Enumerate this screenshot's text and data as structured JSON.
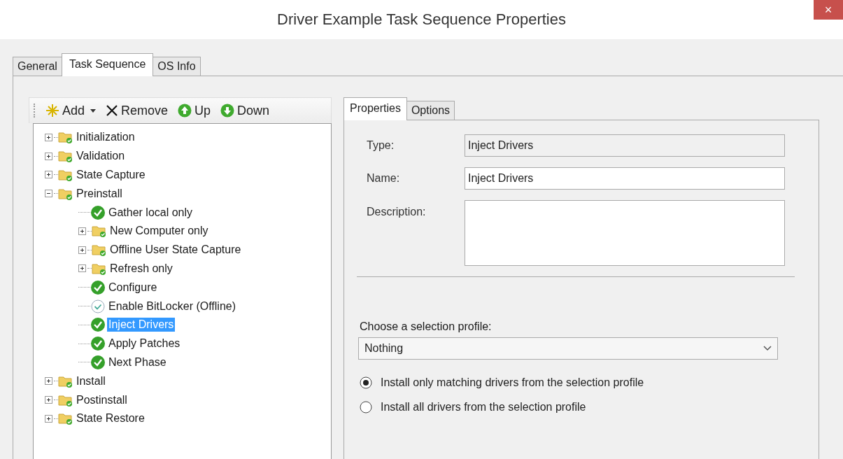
{
  "window": {
    "title": "Driver Example Task Sequence Properties",
    "close": "×"
  },
  "tabs": [
    {
      "label": "General",
      "selected": false
    },
    {
      "label": "Task Sequence",
      "selected": true
    },
    {
      "label": "OS Info",
      "selected": false
    }
  ],
  "toolbar": [
    {
      "label": "Add",
      "kind": "add"
    },
    {
      "label": "Remove",
      "kind": "remove"
    },
    {
      "label": "Up",
      "kind": "up"
    },
    {
      "label": "Down",
      "kind": "down"
    }
  ],
  "tree": [
    {
      "label": "Initialization",
      "kind": "folder",
      "expanded": false,
      "selected": false
    },
    {
      "label": "Validation",
      "kind": "folder",
      "expanded": false,
      "selected": false
    },
    {
      "label": "State Capture",
      "kind": "folder",
      "expanded": false,
      "selected": false
    },
    {
      "label": "Preinstall",
      "kind": "folder",
      "expanded": true,
      "selected": false,
      "children": [
        {
          "label": "Gather local only",
          "kind": "step",
          "selected": false
        },
        {
          "label": "New Computer only",
          "kind": "folder",
          "expanded": false,
          "selected": false
        },
        {
          "label": "Offline User State Capture",
          "kind": "folder",
          "expanded": false,
          "selected": false
        },
        {
          "label": "Refresh only",
          "kind": "folder",
          "expanded": false,
          "selected": false
        },
        {
          "label": "Configure",
          "kind": "step",
          "selected": false
        },
        {
          "label": "Enable BitLocker (Offline)",
          "kind": "step-outline",
          "selected": false
        },
        {
          "label": "Inject Drivers",
          "kind": "step",
          "selected": true
        },
        {
          "label": "Apply Patches",
          "kind": "step",
          "selected": false
        },
        {
          "label": "Next Phase",
          "kind": "step",
          "selected": false
        }
      ]
    },
    {
      "label": "Install",
      "kind": "folder",
      "expanded": false,
      "selected": false
    },
    {
      "label": "Postinstall",
      "kind": "folder",
      "expanded": false,
      "selected": false
    },
    {
      "label": "State Restore",
      "kind": "folder",
      "expanded": false,
      "selected": false
    }
  ],
  "detail_tabs": [
    {
      "label": "Properties",
      "selected": true
    },
    {
      "label": "Options",
      "selected": false
    }
  ],
  "fields": [
    {
      "label": "Type:",
      "value": "Inject Drivers",
      "kind": "readonly"
    },
    {
      "label": "Name:",
      "value": "Inject Drivers",
      "kind": "text"
    },
    {
      "label": "Description:",
      "kind": "multiline"
    }
  ],
  "profile": {
    "label": "Choose a selection profile:",
    "value": "Nothing"
  },
  "options": [
    {
      "label": "Install only matching drivers from the selection profile",
      "selected": true
    },
    {
      "label": "Install all drivers from the selection profile",
      "selected": false
    }
  ]
}
